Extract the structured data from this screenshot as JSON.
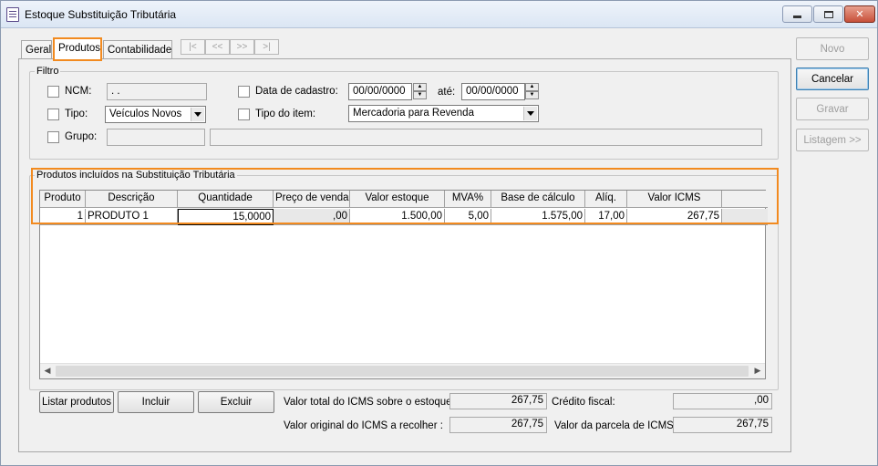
{
  "window": {
    "title": "Estoque Substituição Tributária",
    "controls": {
      "minimize": "",
      "maximize": "",
      "close": "✕"
    }
  },
  "tabs": [
    {
      "label": "Geral"
    },
    {
      "label": "Produtos"
    },
    {
      "label": "Contabilidade"
    }
  ],
  "nav": [
    "|<",
    "<<",
    ">>",
    ">|"
  ],
  "side_buttons": {
    "novo": "Novo",
    "cancelar": "Cancelar",
    "gravar": "Gravar",
    "listagem": "Listagem >>"
  },
  "filtro": {
    "legend": "Filtro",
    "ncm_label": "NCM:",
    "ncm_value": "  .  .  ",
    "tipo_label": "Tipo:",
    "tipo_value": "Veículos Novos",
    "grupo_label": "Grupo:",
    "grupo_code": "",
    "grupo_desc": "",
    "data_label": "Data de cadastro:",
    "data_from": "00/00/0000",
    "ate_label": "até:",
    "data_to": "00/00/0000",
    "tipo_item_label": "Tipo do item:",
    "tipo_item_value": "Mercadoria para Revenda"
  },
  "produtos": {
    "legend": "Produtos incluídos na Substituição Tributária",
    "columns": [
      "Produto",
      "Descrição",
      "Quantidade",
      "Preço de venda",
      "Valor estoque",
      "MVA%",
      "Base de cálculo",
      "Alíq.",
      "Valor ICMS",
      ""
    ],
    "rows": [
      [
        "1",
        "PRODUTO 1",
        "15,0000",
        ",00",
        "1.500,00",
        "5,00",
        "1.575,00",
        "17,00",
        "267,75",
        ""
      ]
    ]
  },
  "bottom_buttons": {
    "listar": "Listar produtos",
    "incluir": "Incluir",
    "excluir": "Excluir"
  },
  "totals": {
    "valor_total_label": "Valor total do ICMS sobre o estoque:",
    "valor_total": "267,75",
    "valor_original_label": "Valor original do ICMS a recolher :",
    "valor_original": "267,75",
    "credito_label": "Crédito fiscal:",
    "credito": ",00",
    "parcela_label": "Valor da parcela de ICMS:",
    "parcela": "267,75"
  }
}
